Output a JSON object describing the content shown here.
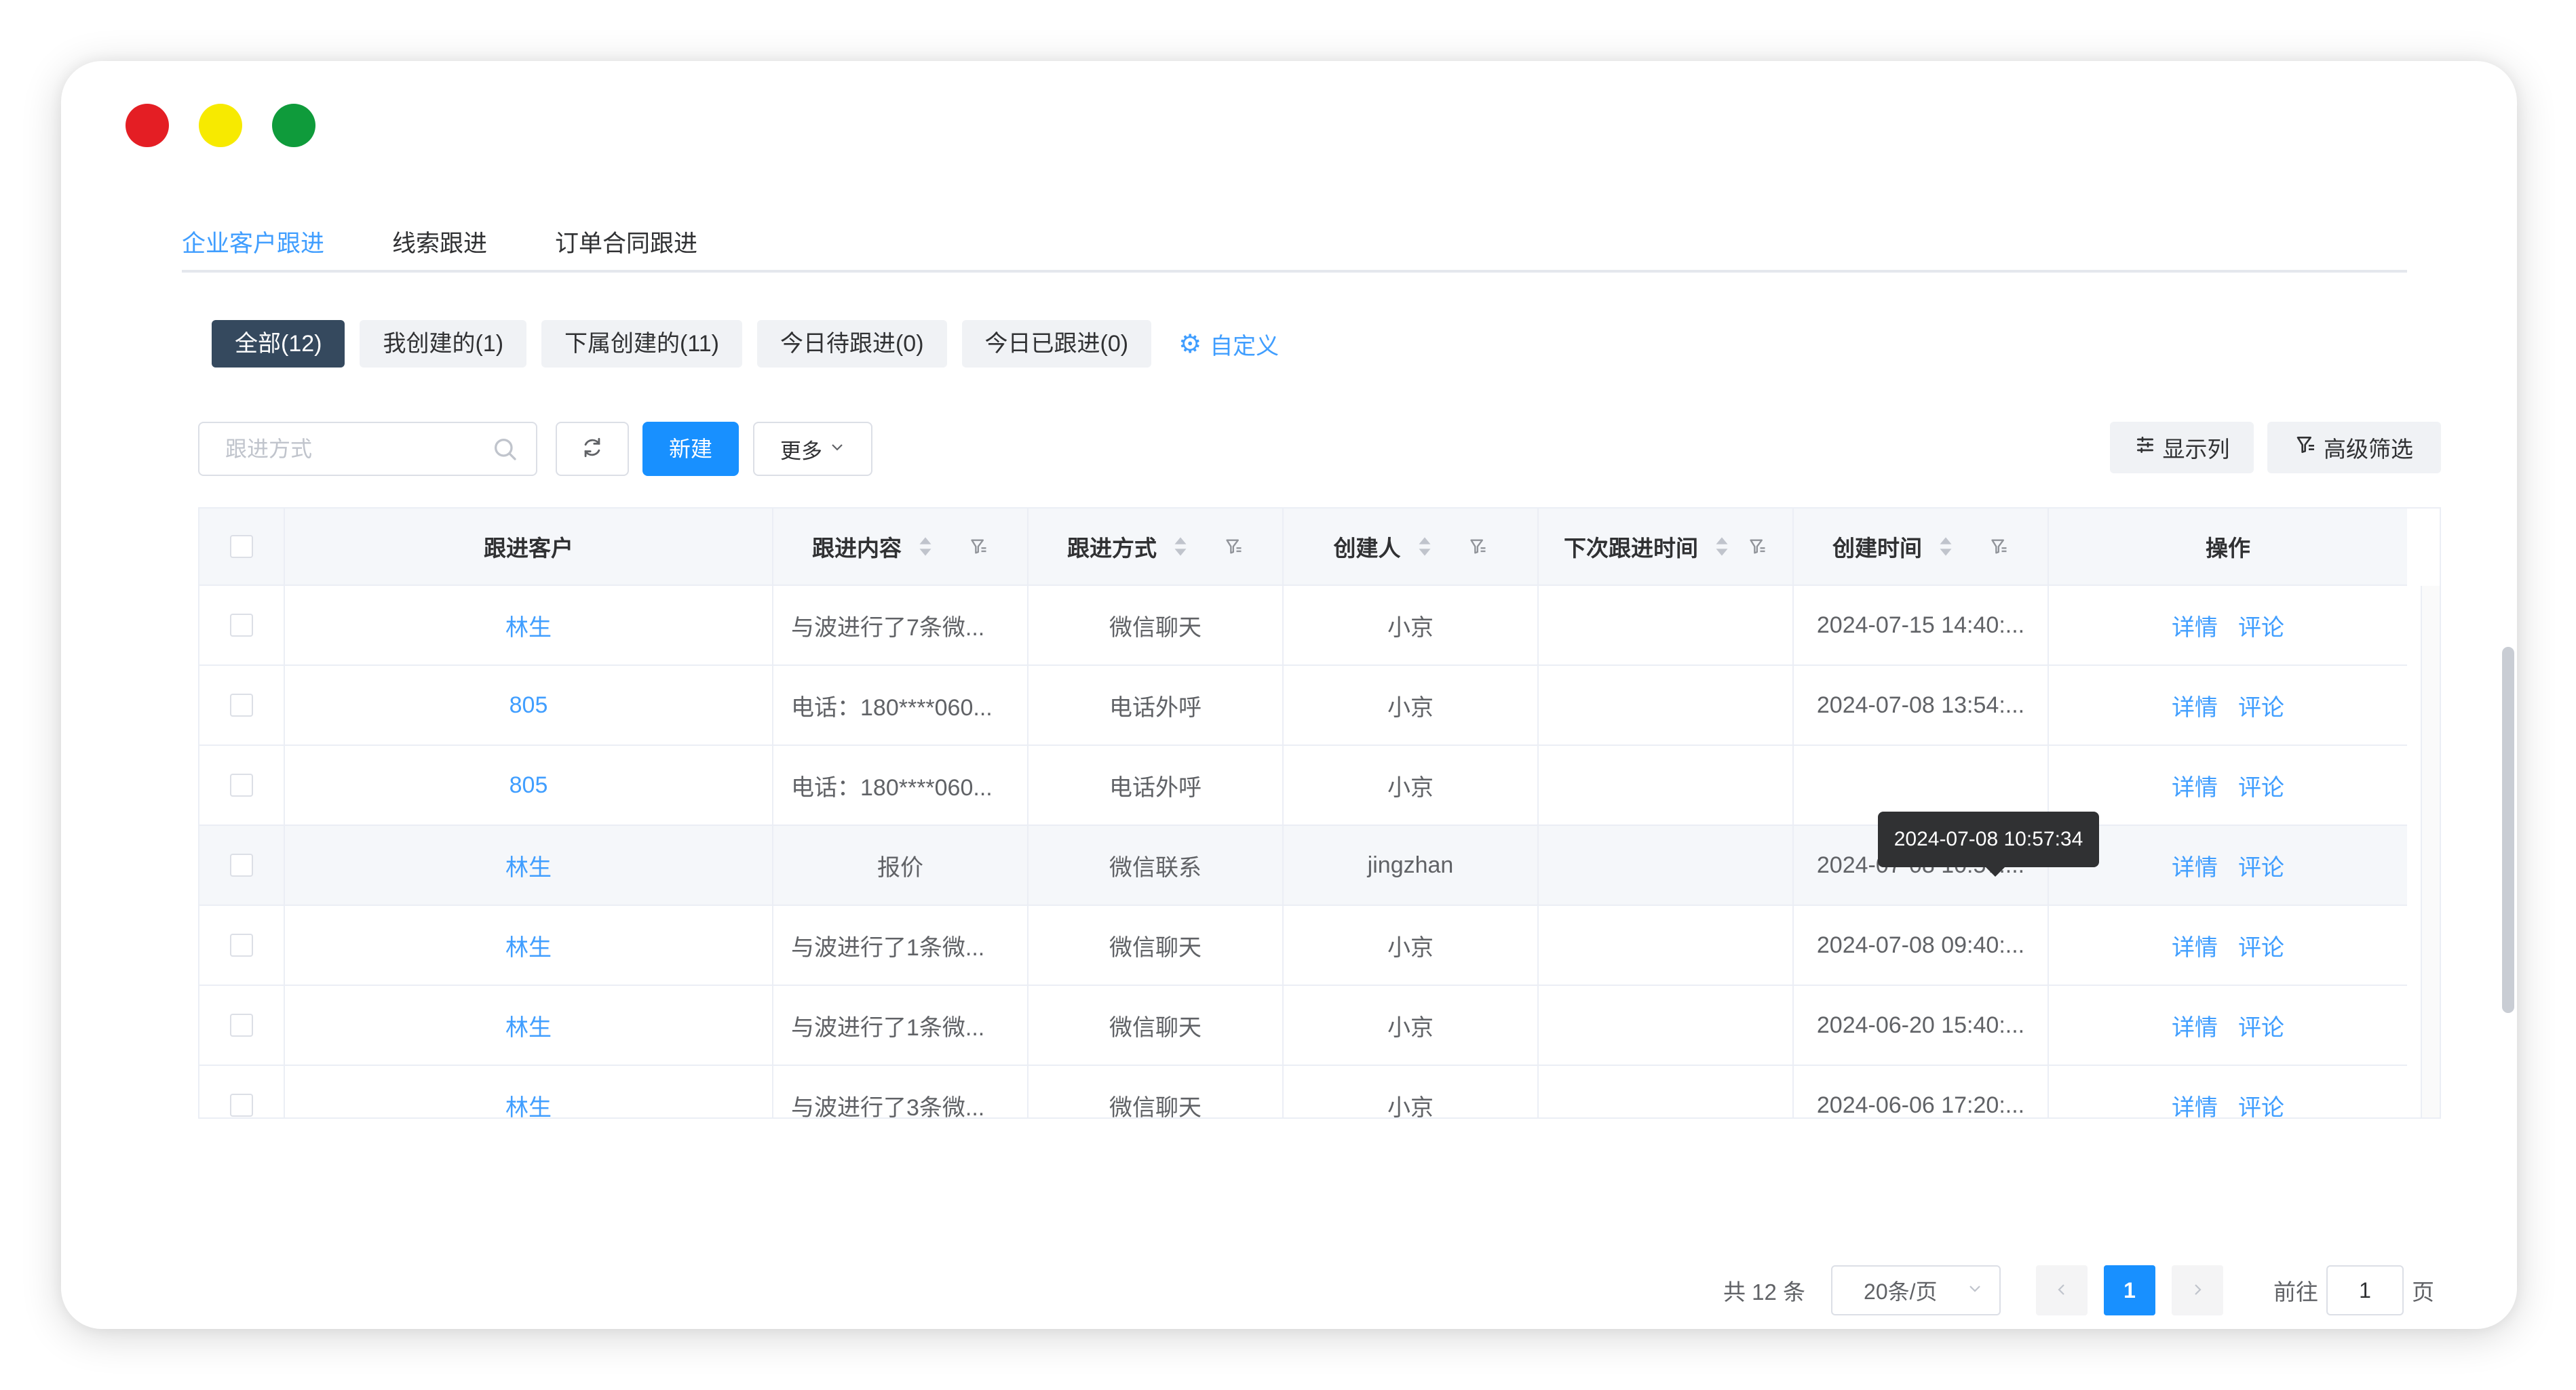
{
  "tabs": [
    {
      "label": "企业客户跟进",
      "active": true
    },
    {
      "label": "线索跟进",
      "active": false
    },
    {
      "label": "订单合同跟进",
      "active": false
    }
  ],
  "segments": [
    {
      "label": "全部(12)",
      "active": true
    },
    {
      "label": "我创建的(1)",
      "active": false
    },
    {
      "label": "下属创建的(11)",
      "active": false
    },
    {
      "label": "今日待跟进(0)",
      "active": false
    },
    {
      "label": "今日已跟进(0)",
      "active": false
    }
  ],
  "customize_label": "自定义",
  "toolbar": {
    "search_placeholder": "跟进方式",
    "new_label": "新建",
    "more_label": "更多",
    "columns_label": "显示列",
    "advanced_filter_label": "高级筛选"
  },
  "table": {
    "headers": [
      "跟进客户",
      "跟进内容",
      "跟进方式",
      "创建人",
      "下次跟进时间",
      "创建时间",
      "操作"
    ],
    "rows": [
      {
        "customer": "林生",
        "content": "与波进行了7条微...",
        "method": "微信聊天",
        "creator": "小京",
        "next_time": "",
        "created": "2024-07-15 14:40:..."
      },
      {
        "customer": "805",
        "content": "电话：180****060...",
        "method": "电话外呼",
        "creator": "小京",
        "next_time": "",
        "created": "2024-07-08 13:54:..."
      },
      {
        "customer": "805",
        "content": "电话：180****060...",
        "method": "电话外呼",
        "creator": "小京",
        "next_time": "",
        "created": ""
      },
      {
        "customer": "林生",
        "content": "报价",
        "method": "微信联系",
        "creator": "jingzhan",
        "next_time": "",
        "created": "2024-07-08 10:57:..."
      },
      {
        "customer": "林生",
        "content": "与波进行了1条微...",
        "method": "微信聊天",
        "creator": "小京",
        "next_time": "",
        "created": "2024-07-08 09:40:..."
      },
      {
        "customer": "林生",
        "content": "与波进行了1条微...",
        "method": "微信聊天",
        "creator": "小京",
        "next_time": "",
        "created": "2024-06-20 15:40:..."
      },
      {
        "customer": "林生",
        "content": "与波进行了3条微...",
        "method": "微信聊天",
        "creator": "小京",
        "next_time": "",
        "created": "2024-06-06 17:20:..."
      }
    ],
    "actions": {
      "detail": "详情",
      "comment": "评论"
    }
  },
  "tooltip": "2024-07-08 10:57:34",
  "pagination": {
    "total_label": "共 12 条",
    "page_size_label": "20条/页",
    "current_page": "1",
    "goto_label": "前往",
    "goto_value": "1",
    "page_suffix": "页"
  },
  "colors": {
    "primary": "#1890ff",
    "link": "#409eff",
    "segment_active": "#35495e",
    "traffic_red": "#e41e24",
    "traffic_yellow": "#f7ea00",
    "traffic_green": "#0f9b3b"
  },
  "icons": {
    "search": "search-icon",
    "refresh": "refresh-icon",
    "gear": "gear-icon",
    "sort": "sort-icon",
    "filter": "filter-icon",
    "columns": "sliders-icon",
    "chevron_down": "chevron-down-icon",
    "chevron_left": "chevron-left-icon",
    "chevron_right": "chevron-right-icon"
  }
}
